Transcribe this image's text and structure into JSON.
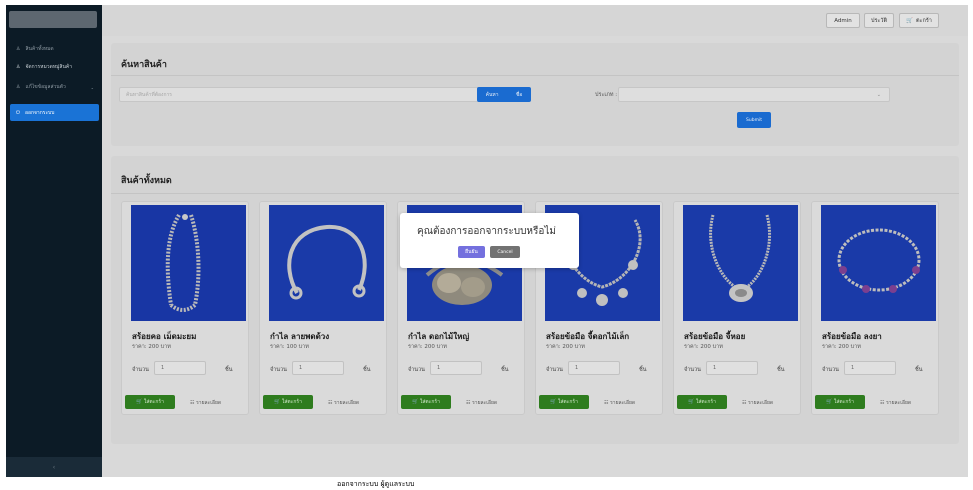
{
  "sidebar": {
    "items": [
      {
        "label": "สินค้าทั้งหมด",
        "icon": "person-icon"
      },
      {
        "label": "จัดการหมวดหมู่สินค้า",
        "icon": "person-icon"
      },
      {
        "label": "แก้ไขข้อมูลส่วนตัว",
        "icon": "person-icon"
      }
    ],
    "active_item": {
      "label": "ออกจากระบบ",
      "icon": "logout-icon"
    },
    "collapse_label": "‹"
  },
  "topbar": {
    "admin_label": "Admin",
    "history_label": "ประวัติ",
    "cart_label": "ตะกร้า"
  },
  "search": {
    "title": "ค้นหาสินค้า",
    "placeholder": "ค้นหาสินค้าที่ต้องการ",
    "search_label": "ค้นหา",
    "search_by_label": "ชื่อ",
    "category_label": "ประเภท :",
    "category_chevron": "⌄",
    "submit_label": "Submit"
  },
  "products_section": {
    "title": "สินค้าทั้งหมด",
    "items": [
      {
        "name": "สร้อยคอ เม็ดมะยม",
        "price": "ราคา: 200 บาท",
        "qty_label": "จำนวน",
        "qty_value": "1",
        "unit": "ชิ้น",
        "add_label": "🛒 ใส่ตะกร้า",
        "detail_label": "☷ รายละเอียด"
      },
      {
        "name": "กำไล ลายพดด้วง",
        "price": "ราคา: 100 บาท",
        "qty_label": "จำนวน",
        "qty_value": "1",
        "unit": "ชิ้น",
        "add_label": "🛒 ใส่ตะกร้า",
        "detail_label": "☷ รายละเอียด"
      },
      {
        "name": "กำไล ดอกไม้ใหญ่",
        "price": "ราคา: 200 บาท",
        "qty_label": "จำนวน",
        "qty_value": "1",
        "unit": "ชิ้น",
        "add_label": "🛒 ใส่ตะกร้า",
        "detail_label": "☷ รายละเอียด"
      },
      {
        "name": "สร้อยข้อมือ จี้ดอกไม้เล็ก",
        "price": "ราคา: 200 บาท",
        "qty_label": "จำนวน",
        "qty_value": "1",
        "unit": "ชิ้น",
        "add_label": "🛒 ใส่ตะกร้า",
        "detail_label": "☷ รายละเอียด"
      },
      {
        "name": "สร้อยข้อมือ จี้หอย",
        "price": "ราคา: 200 บาท",
        "qty_label": "จำนวน",
        "qty_value": "1",
        "unit": "ชิ้น",
        "add_label": "🛒 ใส่ตะกร้า",
        "detail_label": "☷ รายละเอียด"
      },
      {
        "name": "สร้อยข้อมือ ลงยา",
        "price": "ราคา: 200 บาท",
        "qty_label": "จำนวน",
        "qty_value": "1",
        "unit": "ชิ้น",
        "add_label": "🛒 ใส่ตะกร้า",
        "detail_label": "☷ รายละเอียด"
      }
    ]
  },
  "dialog": {
    "message": "คุณต้องการออกจากระบบหรือไม่",
    "confirm_label": "ยืนยัน",
    "cancel_label": "Cancel"
  },
  "caption": "ออกจากระบบ ผู้ดูแลระบบ"
}
